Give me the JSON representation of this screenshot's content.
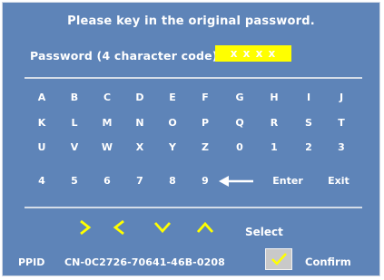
{
  "title": "Please key in the original password.",
  "password": {
    "label": "Password (4 character code):",
    "masked_value": "x x x x"
  },
  "keypad": {
    "rows": [
      [
        "A",
        "B",
        "C",
        "D",
        "E",
        "F",
        "G",
        "H",
        "I",
        "J"
      ],
      [
        "K",
        "L",
        "M",
        "N",
        "O",
        "P",
        "Q",
        "R",
        "S",
        "T"
      ],
      [
        "U",
        "V",
        "W",
        "X",
        "Y",
        "Z",
        "0",
        "1",
        "2",
        "3"
      ],
      [
        "4",
        "5",
        "6",
        "7",
        "8",
        "9"
      ]
    ],
    "enter_label": "Enter",
    "exit_label": "Exit"
  },
  "navigation": {
    "select_label": "Select"
  },
  "footer": {
    "ppid_label": "PPID",
    "ppid_value": "CN-0C2726-70641-46B-0208",
    "confirm_label": "Confirm"
  },
  "colors": {
    "background": "#5e84b8",
    "password_field": "#ffff00",
    "nav_arrows": "#ffff00",
    "text": "#ffffff"
  }
}
